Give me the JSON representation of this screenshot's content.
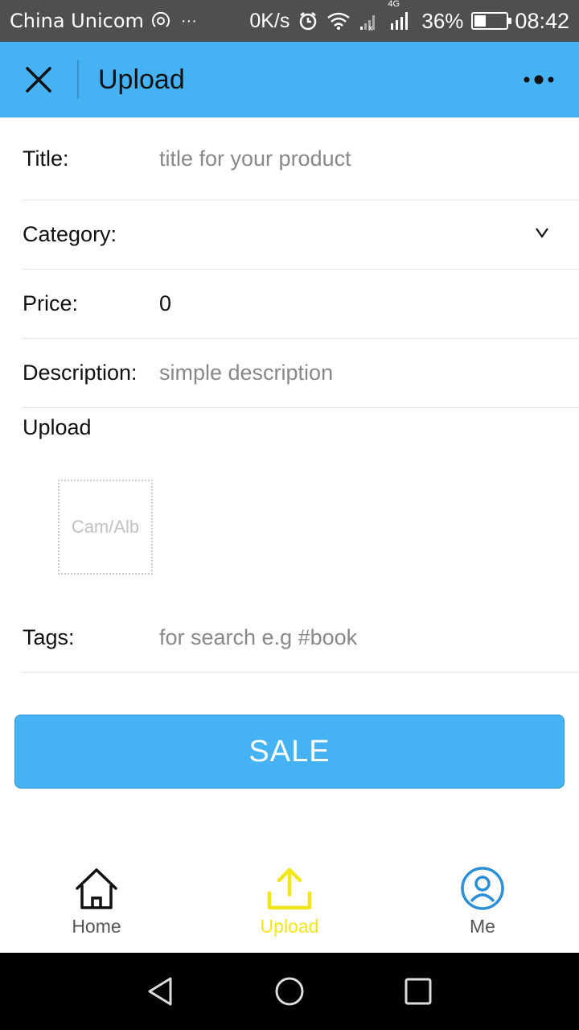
{
  "status_bar": {
    "carrier": "China Unicom",
    "net_speed": "0K/s",
    "network_type": "4G",
    "battery_percent": "36%",
    "battery_level": 0.36,
    "time": "08:42"
  },
  "header": {
    "title": "Upload",
    "close_icon": "close-icon",
    "more_icon": "more-dots-icon"
  },
  "form": {
    "title": {
      "label": "Title:",
      "placeholder": "title for your product",
      "value": ""
    },
    "category": {
      "label": "Category:",
      "value": ""
    },
    "price": {
      "label": "Price:",
      "value": "0"
    },
    "description": {
      "label": "Description:",
      "placeholder": "simple description",
      "value": ""
    },
    "upload": {
      "label": "Upload",
      "picker_text": "Cam/Alb"
    },
    "tags": {
      "label": "Tags:",
      "placeholder": "for search e.g #book",
      "value": ""
    }
  },
  "sale_button": {
    "label": "SALE"
  },
  "tab_bar": {
    "items": [
      {
        "label": "Home",
        "icon": "home-icon"
      },
      {
        "label": "Upload",
        "icon": "upload-icon",
        "active": true
      },
      {
        "label": "Me",
        "icon": "user-icon"
      }
    ]
  },
  "colors": {
    "accent": "#45b2f3",
    "active_tab": "#f2e61a",
    "me_icon": "#2a8fd6",
    "status_bar": "#4f4f4f"
  }
}
